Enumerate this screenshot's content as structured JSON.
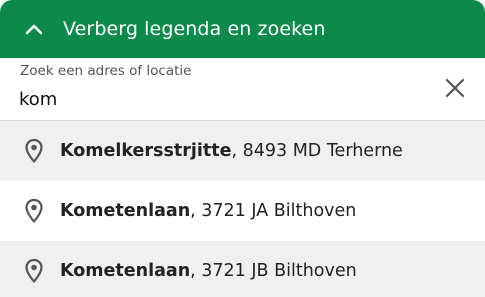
{
  "header": {
    "title": "Verberg legenda en zoeken",
    "icon": "chevron-up-icon",
    "color": "#0b8a4c"
  },
  "search": {
    "label": "Zoek een adres of locatie",
    "value": "kom",
    "clear_icon": "close-icon"
  },
  "results": [
    {
      "name": "Komelkersstrjitte",
      "rest": ", 8493 MD Terherne",
      "icon": "map-pin-icon"
    },
    {
      "name": "Kometenlaan",
      "rest": ", 3721 JA Bilthoven",
      "icon": "map-pin-icon"
    },
    {
      "name": "Kometenlaan",
      "rest": ", 3721 JB Bilthoven",
      "icon": "map-pin-icon"
    }
  ]
}
